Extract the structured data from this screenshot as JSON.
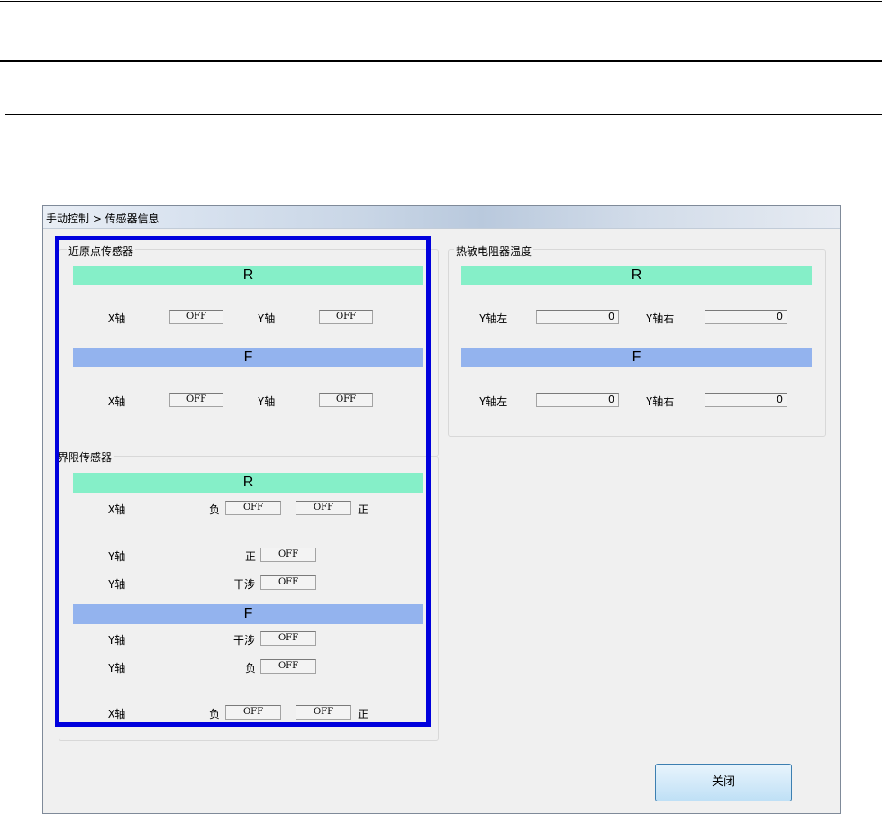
{
  "window": {
    "title": "手动控制 > 传感器信息"
  },
  "near_origin": {
    "title": "近原点传感器",
    "R": {
      "band": "R",
      "x_label": "X轴",
      "x_value": "OFF",
      "y_label": "Y轴",
      "y_value": "OFF"
    },
    "F": {
      "band": "F",
      "x_label": "X轴",
      "x_value": "OFF",
      "y_label": "Y轴",
      "y_value": "OFF"
    }
  },
  "limit": {
    "title": "界限传感器",
    "R": {
      "band": "R",
      "x_label": "X轴",
      "x_neg_label": "负",
      "x_neg_value": "OFF",
      "x_pos_value": "OFF",
      "x_pos_label": "正",
      "y1_label": "Y轴",
      "y1_sub": "正",
      "y1_value": "OFF",
      "y2_label": "Y轴",
      "y2_sub": "干涉",
      "y2_value": "OFF"
    },
    "F": {
      "band": "F",
      "y1_label": "Y轴",
      "y1_sub": "干涉",
      "y1_value": "OFF",
      "y2_label": "Y轴",
      "y2_sub": "负",
      "y2_value": "OFF",
      "x_label": "X轴",
      "x_neg_label": "负",
      "x_neg_value": "OFF",
      "x_pos_value": "OFF",
      "x_pos_label": "正"
    }
  },
  "thermistor": {
    "title": "热敏电阻器温度",
    "R": {
      "band": "R",
      "left_label": "Y轴左",
      "left_value": "0",
      "right_label": "Y轴右",
      "right_value": "0"
    },
    "F": {
      "band": "F",
      "left_label": "Y轴左",
      "left_value": "0",
      "right_label": "Y轴右",
      "right_value": "0"
    }
  },
  "buttons": {
    "close": "关闭"
  },
  "colors": {
    "band_r": "#85efc8",
    "band_f": "#93b3ee",
    "highlight": "#0000dd"
  }
}
